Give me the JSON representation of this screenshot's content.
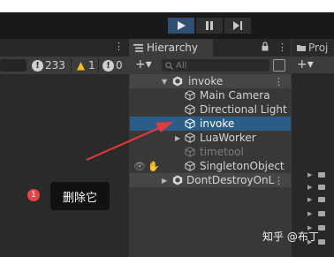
{
  "toolbar": {
    "play_icon": "play-icon",
    "pause_icon": "pause-icon",
    "step_icon": "step-icon",
    "accent": "#2f4f74"
  },
  "console": {
    "menu": "⋮",
    "info_count": "233",
    "warn_count": "1",
    "error_count": "0"
  },
  "hierarchy": {
    "tab_label": "Hierarchy",
    "menu": "⋮",
    "add_label": "+▾",
    "search_placeholder": "All",
    "scene": {
      "name": "invoke",
      "menu": "⋮"
    },
    "items": [
      {
        "label": "Main Camera"
      },
      {
        "label": "Directional Light"
      },
      {
        "label": "invoke"
      },
      {
        "label": "LuaWorker"
      },
      {
        "label": "timetool"
      },
      {
        "label": "SingletonObject"
      }
    ],
    "dontdestroy": {
      "name": "DontDestroyOnL",
      "menu": "⋮"
    },
    "selection_color": "#2c5d87"
  },
  "project": {
    "tab_label": "Proj",
    "add_label": "+▾"
  },
  "annotation": {
    "badge": "1",
    "text": "删除它",
    "arrow_color": "#e8393a"
  },
  "watermark": "知乎 @布丁"
}
